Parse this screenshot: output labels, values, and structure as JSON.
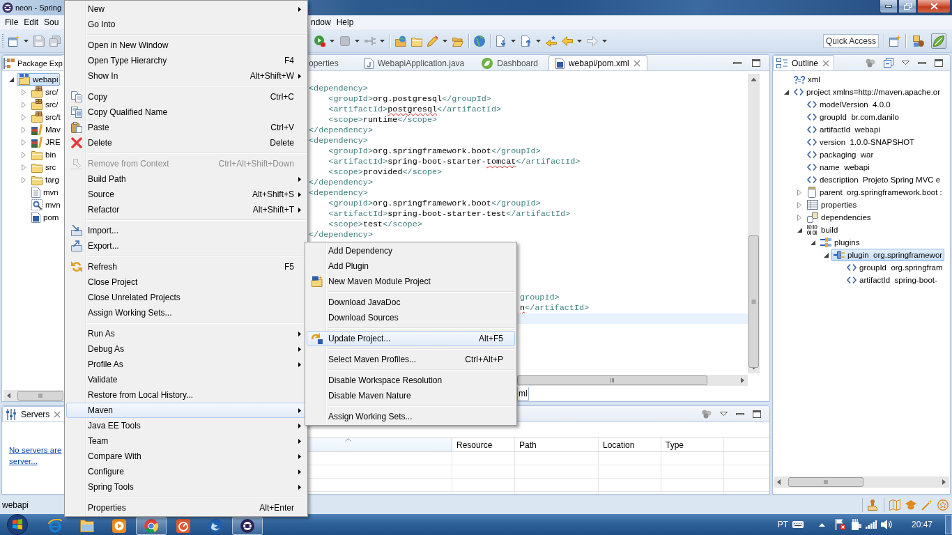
{
  "window": {
    "title": "neon - Spring"
  },
  "menu_bar": {
    "left": [
      "File",
      "Edit",
      "Sou"
    ],
    "right": [
      "ndow",
      "Help"
    ]
  },
  "toolbar": {
    "quick_access": {
      "placeholder": "Quick Access"
    },
    "perspectives": [
      {
        "selected": false
      },
      {
        "selected": true
      }
    ]
  },
  "package_explorer": {
    "tab": "Package Exp",
    "tree": [
      {
        "label": "webapi",
        "kind": "project",
        "expanded": true,
        "selected": true,
        "children": [
          {
            "label": "src/",
            "kind": "source-folder",
            "expanded": false,
            "selected": false
          },
          {
            "label": "src/",
            "kind": "source-folder",
            "expanded": false,
            "selected": false
          },
          {
            "label": "src/t",
            "kind": "source-folder",
            "expanded": false,
            "selected": false
          },
          {
            "label": "Mav",
            "kind": "library",
            "expanded": false,
            "selected": false
          },
          {
            "label": "JRE",
            "kind": "library",
            "expanded": false,
            "selected": false
          },
          {
            "label": "bin",
            "kind": "folder",
            "expanded": false,
            "selected": false
          },
          {
            "label": "src",
            "kind": "folder",
            "expanded": false,
            "selected": false
          },
          {
            "label": "targ",
            "kind": "folder",
            "expanded": false,
            "selected": false
          },
          {
            "label": "mvn",
            "kind": "text-file",
            "selected": false
          },
          {
            "label": "mvn",
            "kind": "settings-file",
            "selected": false
          },
          {
            "label": "pom",
            "kind": "maven-file",
            "selected": false
          }
        ]
      }
    ]
  },
  "servers": {
    "tab": "Servers",
    "link_lines": [
      "No servers are",
      "server..."
    ]
  },
  "editor": {
    "tabs": [
      {
        "label": "operties",
        "selected": false
      },
      {
        "label": "WebapiApplication.java",
        "kind": "java",
        "selected": false
      },
      {
        "label": "Dashboard",
        "kind": "spring",
        "selected": false
      },
      {
        "label": "webapi/pom.xml",
        "kind": "maven",
        "selected": true
      }
    ],
    "lines": [
      {
        "tokens": [
          {
            "kind": "tag",
            "text": "<dependency>"
          }
        ],
        "children": [
          {
            "tokens": [
              {
                "kind": "tag",
                "text": "<groupId>"
              },
              {
                "kind": "text",
                "text": "org.postgresql"
              },
              {
                "kind": "tag",
                "text": "</groupId>"
              }
            ]
          },
          {
            "tokens": [
              {
                "kind": "tag",
                "text": "<artifactId>"
              },
              {
                "kind": "misspelled",
                "text": "postgresql"
              },
              {
                "kind": "tag",
                "text": "</artifactId>"
              }
            ]
          },
          {
            "tokens": [
              {
                "kind": "tag",
                "text": "<scope>"
              },
              {
                "kind": "text",
                "text": "runtime"
              },
              {
                "kind": "tag",
                "text": "</scope>"
              }
            ]
          }
        ]
      },
      {
        "tokens": [
          {
            "kind": "tag",
            "text": "</dependency>"
          }
        ]
      },
      {
        "tokens": [
          {
            "kind": "tag",
            "text": "<dependency>"
          }
        ],
        "children": [
          {
            "tokens": [
              {
                "kind": "tag",
                "text": "<groupId>"
              },
              {
                "kind": "text",
                "text": "org.springframework.boot"
              },
              {
                "kind": "tag",
                "text": "</groupId>"
              }
            ]
          },
          {
            "tokens": [
              {
                "kind": "tag",
                "text": "<artifactId>"
              },
              {
                "kind": "text",
                "text": "spring-boot-starter-"
              },
              {
                "kind": "misspelled",
                "text": "tomcat"
              },
              {
                "kind": "tag",
                "text": "</artifactId>"
              }
            ]
          },
          {
            "tokens": [
              {
                "kind": "tag",
                "text": "<scope>"
              },
              {
                "kind": "text",
                "text": "provided"
              },
              {
                "kind": "tag",
                "text": "</scope>"
              }
            ]
          }
        ]
      },
      {
        "tokens": [
          {
            "kind": "tag",
            "text": "</dependency>"
          }
        ]
      },
      {
        "tokens": [
          {
            "kind": "tag",
            "text": "<dependency>"
          }
        ],
        "children": [
          {
            "tokens": [
              {
                "kind": "tag",
                "text": "<groupId>"
              },
              {
                "kind": "text",
                "text": "org.springframework.boot"
              },
              {
                "kind": "tag",
                "text": "</groupId>"
              }
            ]
          },
          {
            "tokens": [
              {
                "kind": "tag",
                "text": "<artifactId>"
              },
              {
                "kind": "text",
                "text": "spring-boot-starter-test"
              },
              {
                "kind": "tag",
                "text": "</artifactId>"
              }
            ]
          },
          {
            "tokens": [
              {
                "kind": "tag",
                "text": "<scope>"
              },
              {
                "kind": "text",
                "text": "test"
              },
              {
                "kind": "tag",
                "text": "</scope>"
              }
            ]
          }
        ]
      },
      {
        "tokens": [
          {
            "kind": "tag",
            "text": "</dependency>"
          }
        ]
      }
    ],
    "partial_lines": [
      {
        "tokens": [
          {
            "kind": "tag",
            "text": "groupId>"
          }
        ],
        "current": false
      },
      {
        "tokens": [
          {
            "kind": "misspelled",
            "text": "n"
          },
          {
            "kind": "tag",
            "text": "</artifactId>"
          }
        ],
        "current": false
      },
      {
        "current": true
      }
    ],
    "page_tabs": [
      {
        "label": "ml",
        "selected": true
      }
    ]
  },
  "bottom_panel": {
    "table": {
      "columns": [
        {
          "sorted": true
        },
        {
          "label": "Resource",
          "sorted": false
        },
        {
          "label": "Path",
          "sorted": false
        },
        {
          "label": "Location",
          "sorted": false
        },
        {
          "label": "Type",
          "sorted": false
        }
      ]
    }
  },
  "outline": {
    "tab": "Outline",
    "tree": [
      {
        "label": "xml",
        "kind": "processing-instruction",
        "selected": false
      },
      {
        "label": "project xmlns=http://maven.apache.or",
        "kind": "element",
        "expanded": true,
        "selected": false,
        "children": [
          {
            "label": "modelVersion  4.0.0",
            "kind": "element",
            "selected": false
          },
          {
            "label": "groupId  br.com.danilo",
            "kind": "element",
            "selected": false
          },
          {
            "label": "artifactId  webapi",
            "kind": "element",
            "selected": false
          },
          {
            "label": "version  1.0.0-SNAPSHOT",
            "kind": "element",
            "selected": false
          },
          {
            "label": "packaging  war",
            "kind": "element",
            "selected": false
          },
          {
            "label": "name  webapi",
            "kind": "element",
            "selected": false
          },
          {
            "label": "description  Projeto Spring MVC e",
            "kind": "element",
            "selected": false
          },
          {
            "label": "parent  org.springframework.boot :",
            "kind": "parent",
            "expanded": false,
            "selected": false
          },
          {
            "label": "properties",
            "kind": "properties",
            "expanded": false,
            "selected": false
          },
          {
            "label": "dependencies",
            "kind": "dependencies",
            "expanded": false,
            "selected": false
          },
          {
            "label": "build",
            "kind": "build",
            "expanded": true,
            "selected": false,
            "children": [
              {
                "label": "plugins",
                "kind": "plugins",
                "expanded": true,
                "selected": false,
                "children": [
                  {
                    "label": "plugin  org.springframewor",
                    "kind": "plugin",
                    "expanded": true,
                    "selected": true,
                    "children": [
                      {
                        "label": "groupId  org.springfram",
                        "kind": "element",
                        "selected": false
                      },
                      {
                        "label": "artifactId  spring-boot-",
                        "kind": "element",
                        "selected": false
                      }
                    ]
                  }
                ]
              }
            ]
          }
        ]
      }
    ]
  },
  "status_bar": {
    "text": "webapi"
  },
  "taskbar": {
    "apps": [
      {
        "running": false
      },
      {
        "running": false
      },
      {
        "running": false
      },
      {
        "running": true
      },
      {
        "running": false
      },
      {
        "running": false
      },
      {
        "running": true
      }
    ],
    "language": "PT",
    "clock": "20:47"
  },
  "context_menu": {
    "groups": [
      [
        {
          "label": "New",
          "kind": "submenu",
          "disabled": false,
          "selected": false
        },
        {
          "label": "Go Into",
          "kind": "command",
          "disabled": false,
          "selected": false
        }
      ],
      [
        {
          "label": "Open in New Window",
          "kind": "command",
          "disabled": false,
          "selected": false
        },
        {
          "label": "Open Type Hierarchy",
          "shortcut": "F4",
          "kind": "command",
          "disabled": false,
          "selected": false
        },
        {
          "label": "Show In",
          "shortcut": "Alt+Shift+W",
          "kind": "submenu",
          "disabled": false,
          "selected": false
        }
      ],
      [
        {
          "label": "Copy",
          "shortcut": "Ctrl+C",
          "kind": "command",
          "disabled": false,
          "selected": false
        },
        {
          "label": "Copy Qualified Name",
          "kind": "command",
          "disabled": false,
          "selected": false
        },
        {
          "label": "Paste",
          "shortcut": "Ctrl+V",
          "kind": "command",
          "disabled": false,
          "selected": false
        },
        {
          "label": "Delete",
          "shortcut": "Delete",
          "kind": "command",
          "disabled": false,
          "selected": false
        }
      ],
      [
        {
          "label": "Remove from Context",
          "shortcut": "Ctrl+Alt+Shift+Down",
          "kind": "command",
          "disabled": true,
          "selected": false
        },
        {
          "label": "Build Path",
          "kind": "submenu",
          "disabled": false,
          "selected": false
        },
        {
          "label": "Source",
          "shortcut": "Alt+Shift+S",
          "kind": "submenu",
          "disabled": false,
          "selected": false
        },
        {
          "label": "Refactor",
          "shortcut": "Alt+Shift+T",
          "kind": "submenu",
          "disabled": false,
          "selected": false
        }
      ],
      [
        {
          "label": "Import...",
          "kind": "command",
          "disabled": false,
          "selected": false
        },
        {
          "label": "Export...",
          "kind": "command",
          "disabled": false,
          "selected": false
        }
      ],
      [
        {
          "label": "Refresh",
          "shortcut": "F5",
          "kind": "command",
          "disabled": false,
          "selected": false
        },
        {
          "label": "Close Project",
          "kind": "command",
          "disabled": false,
          "selected": false
        },
        {
          "label": "Close Unrelated Projects",
          "kind": "command",
          "disabled": false,
          "selected": false
        },
        {
          "label": "Assign Working Sets...",
          "kind": "command",
          "disabled": false,
          "selected": false
        }
      ],
      [
        {
          "label": "Run As",
          "kind": "submenu",
          "disabled": false,
          "selected": false
        },
        {
          "label": "Debug As",
          "kind": "submenu",
          "disabled": false,
          "selected": false
        },
        {
          "label": "Profile As",
          "kind": "submenu",
          "disabled": false,
          "selected": false
        },
        {
          "label": "Validate",
          "kind": "command",
          "disabled": false,
          "selected": false
        },
        {
          "label": "Restore from Local History...",
          "kind": "command",
          "disabled": false,
          "selected": false
        },
        {
          "label": "Maven",
          "kind": "submenu",
          "disabled": false,
          "selected": true
        },
        {
          "label": "Java EE Tools",
          "kind": "submenu",
          "disabled": false,
          "selected": false
        },
        {
          "label": "Team",
          "kind": "submenu",
          "disabled": false,
          "selected": false
        },
        {
          "label": "Compare With",
          "kind": "submenu",
          "disabled": false,
          "selected": false
        },
        {
          "label": "Configure",
          "kind": "submenu",
          "disabled": false,
          "selected": false
        },
        {
          "label": "Spring Tools",
          "kind": "submenu",
          "disabled": false,
          "selected": false
        }
      ],
      [
        {
          "label": "Properties",
          "shortcut": "Alt+Enter",
          "kind": "command",
          "disabled": false,
          "selected": false
        }
      ]
    ]
  },
  "maven_submenu": {
    "groups": [
      [
        {
          "label": "Add Dependency",
          "disabled": false,
          "selected": false
        },
        {
          "label": "Add Plugin",
          "disabled": false,
          "selected": false
        },
        {
          "label": "New Maven Module Project",
          "disabled": false,
          "selected": false
        }
      ],
      [
        {
          "label": "Download JavaDoc",
          "disabled": false,
          "selected": false
        },
        {
          "label": "Download Sources",
          "disabled": false,
          "selected": false
        }
      ],
      [
        {
          "label": "Update Project...",
          "shortcut": "Alt+F5",
          "disabled": false,
          "selected": true
        }
      ],
      [
        {
          "label": "Select Maven Profiles...",
          "shortcut": "Ctrl+Alt+P",
          "disabled": false,
          "selected": false
        }
      ],
      [
        {
          "label": "Disable Workspace Resolution",
          "disabled": false,
          "selected": false
        },
        {
          "label": "Disable Maven Nature",
          "disabled": false,
          "selected": false
        }
      ],
      [
        {
          "label": "Assign Working Sets...",
          "disabled": false,
          "selected": false
        }
      ]
    ]
  }
}
